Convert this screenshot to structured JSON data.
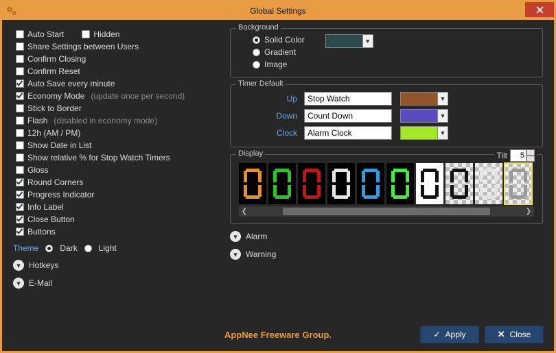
{
  "window": {
    "title": "Global Settings"
  },
  "left": {
    "options": [
      {
        "label": "Auto Start",
        "checked": false
      },
      {
        "label": "Hidden",
        "checked": false,
        "inline_after": 0
      },
      {
        "label": "Share Settings between Users",
        "checked": false
      },
      {
        "label": "Confirm Closing",
        "checked": false
      },
      {
        "label": "Confirm Reset",
        "checked": false
      },
      {
        "label": "Auto Save every minute",
        "checked": true
      },
      {
        "label": "Economy Mode",
        "checked": true,
        "note": "(update once per second)"
      },
      {
        "label": "Stick to Border",
        "checked": false
      },
      {
        "label": "Flash",
        "checked": false,
        "note": "(disabled in economy mode)"
      },
      {
        "label": "12h (AM / PM)",
        "checked": false
      },
      {
        "label": "Show Date in List",
        "checked": false
      },
      {
        "label": "Show relative % for Stop Watch Timers",
        "checked": false
      },
      {
        "label": "Gloss",
        "checked": false
      },
      {
        "label": "Round Corners",
        "checked": true
      },
      {
        "label": "Progress Indicator",
        "checked": true
      },
      {
        "label": "Info Label",
        "checked": true
      },
      {
        "label": "Close Button",
        "checked": true
      },
      {
        "label": "Buttons",
        "checked": true
      }
    ],
    "theme_label": "Theme",
    "theme_options": {
      "dark": "Dark",
      "light": "Light",
      "selected": "dark"
    },
    "expanders": {
      "hotkeys": "Hotkeys",
      "email": "E-Mail"
    }
  },
  "background": {
    "legend": "Background",
    "options": {
      "solid": "Solid Color",
      "gradient": "Gradient",
      "image": "Image",
      "selected": "solid"
    },
    "color": "#2b4a49"
  },
  "timer": {
    "legend": "Timer Default",
    "rows": {
      "up": {
        "label": "Up",
        "value": "Stop Watch",
        "color": "#90552a"
      },
      "down": {
        "label": "Down",
        "value": "Count Down",
        "color": "#5b4bc1"
      },
      "clock": {
        "label": "Clock",
        "value": "Alarm Clock",
        "color": "#a4e829"
      }
    }
  },
  "display": {
    "legend": "Display",
    "tilt_label": "Tilt",
    "tilt_value": "5",
    "digits": [
      {
        "bg": "black",
        "fg": "#e89028"
      },
      {
        "bg": "black",
        "fg": "#29c629"
      },
      {
        "bg": "black",
        "fg": "#c01818"
      },
      {
        "bg": "black",
        "fg": "#e7e7e7"
      },
      {
        "bg": "black",
        "fg": "#2e9ee4"
      },
      {
        "bg": "black",
        "fg": "#3df03d"
      },
      {
        "bg": "white",
        "fg": "#111111"
      },
      {
        "bg": "trans",
        "fg": "#111111"
      },
      {
        "bg": "trans",
        "fg": "#e3e3e3"
      },
      {
        "bg": "trans",
        "fg": "#9a9a9a",
        "selected": true
      }
    ]
  },
  "expanders_right": {
    "alarm": "Alarm",
    "warning": "Warning"
  },
  "footer": {
    "brand": "AppNee Freeware Group.",
    "apply": "Apply",
    "close": "Close"
  }
}
